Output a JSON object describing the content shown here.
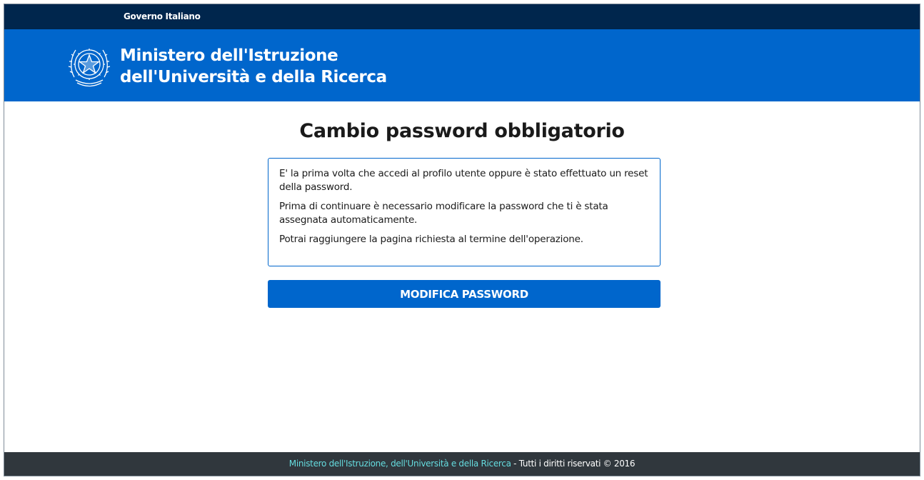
{
  "top_bar": {
    "government_link": "Governo Italiano"
  },
  "header": {
    "ministry_line1": "Ministero dell'Istruzione",
    "ministry_line2": "dell'Università e della Ricerca",
    "emblem_icon": "italian-republic-emblem-icon"
  },
  "main": {
    "title": "Cambio password obbligatorio",
    "info_paragraphs": [
      "E' la prima volta che accedi al profilo utente oppure è stato effettuato un reset della password.",
      "Prima di continuare è necessario modificare la password che ti è stata assegnata automaticamente.",
      "Potrai raggiungere la pagina richiesta al termine dell'operazione."
    ],
    "button_label": "MODIFICA PASSWORD"
  },
  "footer": {
    "ministry_link": "Ministero dell'Istruzione, dell'Università e della Ricerca",
    "rights_text": " - Tutti i diritti riservati © 2016"
  },
  "colors": {
    "gov_bar": "#00264d",
    "header": "#0066cc",
    "button": "#0066cc",
    "footer": "#30373d",
    "footer_link": "#65dcdf"
  }
}
